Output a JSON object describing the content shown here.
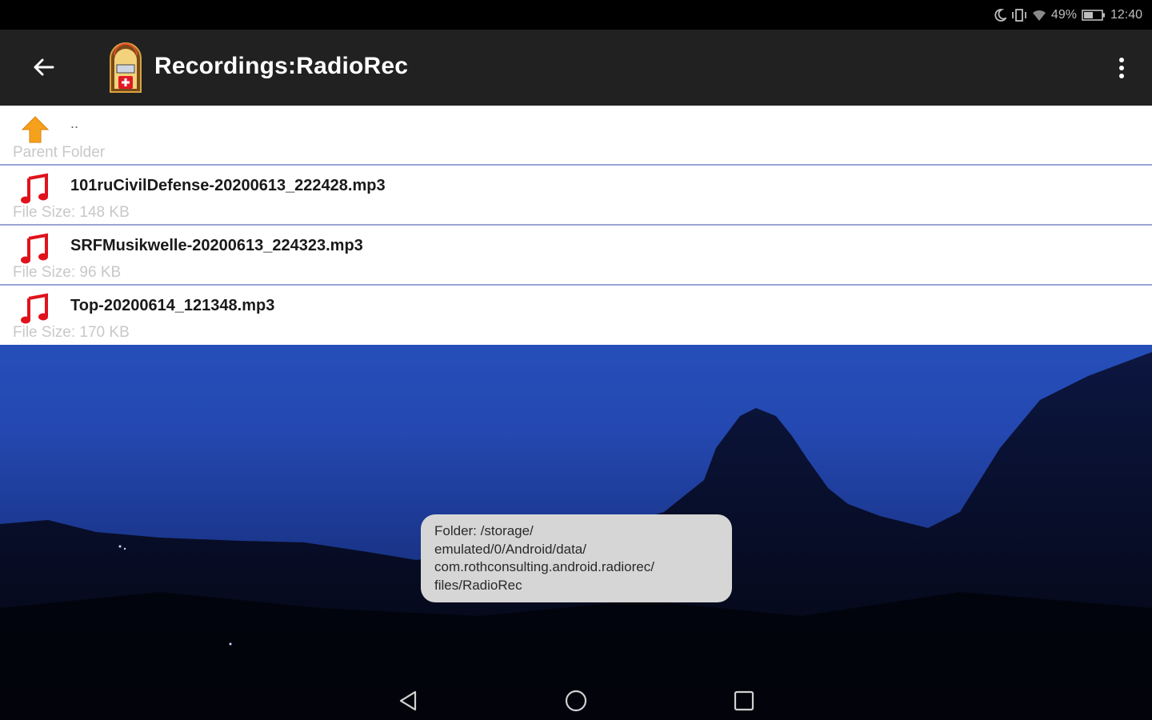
{
  "status_bar": {
    "battery": "49%",
    "time": "12:40",
    "icons": [
      "moon-icon",
      "vibrate-icon",
      "wifi-icon",
      "battery-icon"
    ]
  },
  "app_bar": {
    "title": "Recordings:RadioRec",
    "back_icon": "back-arrow-icon",
    "app_icon": "jukebox-icon",
    "menu_icon": "overflow-menu-icon"
  },
  "file_list": {
    "parent": {
      "title": "..",
      "subtitle": "Parent Folder",
      "icon": "up-arrow-icon"
    },
    "files": [
      {
        "name": "101ruCivilDefense-20200613_222428.mp3",
        "size": "File Size: 148 KB",
        "icon": "music-note-icon"
      },
      {
        "name": "SRFMusikwelle-20200613_224323.mp3",
        "size": "File Size: 96 KB",
        "icon": "music-note-icon"
      },
      {
        "name": "Top-20200614_121348.mp3",
        "size": "File Size: 170 KB",
        "icon": "music-note-icon"
      }
    ]
  },
  "toast": {
    "lines": [
      "Folder: /storage/",
      "emulated/0/Android/data/",
      "com.rothconsulting.android.radiorec/",
      "files/RadioRec"
    ]
  },
  "nav_bar": {
    "icons": [
      "nav-back-icon",
      "nav-home-icon",
      "nav-recents-icon"
    ]
  },
  "colors": {
    "app_bar": "#212121",
    "row_divider": "#9aa4d6",
    "music_icon": "#e0121b",
    "up_arrow": "#f5a11c",
    "toast_bg": "#d6d6d6"
  }
}
